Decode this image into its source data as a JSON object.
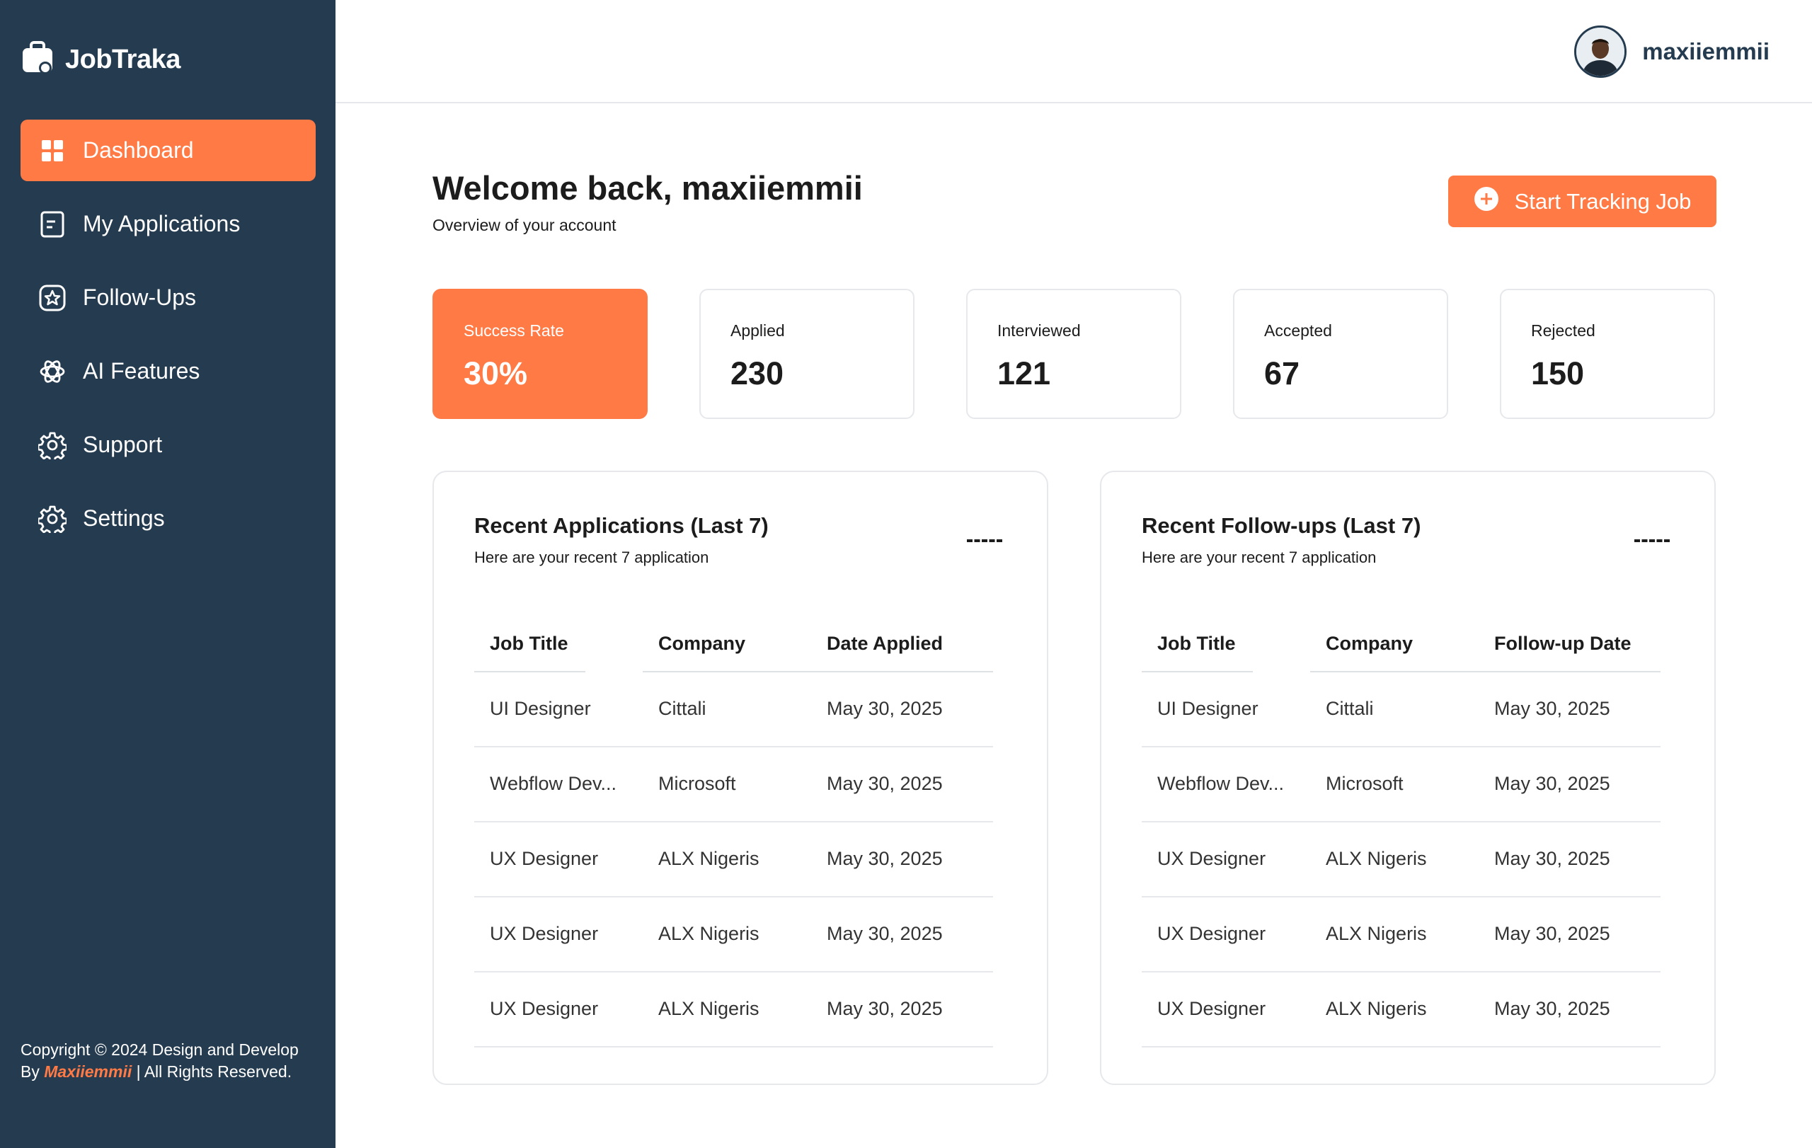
{
  "app": {
    "name": "JobTraka"
  },
  "sidebar": {
    "items": [
      {
        "label": "Dashboard",
        "icon": "dashboard-grid-icon",
        "active": true
      },
      {
        "label": "My Applications",
        "icon": "document-icon"
      },
      {
        "label": "Follow-Ups",
        "icon": "star-badge-icon"
      },
      {
        "label": "AI Features",
        "icon": "ai-knot-icon"
      },
      {
        "label": "Support",
        "icon": "gear-icon"
      },
      {
        "label": "Settings",
        "icon": "gear-icon"
      }
    ],
    "copyright_pre": "Copyright © 2024 Design and Develop By ",
    "copyright_brand": "Maxiiemmii",
    "copyright_post": " | All Rights Reserved."
  },
  "header": {
    "username": "maxiiemmii"
  },
  "main": {
    "welcome": "Welcome back, maxiiemmii",
    "subtitle": "Overview of your account",
    "start_button": "Start Tracking Job"
  },
  "stats": [
    {
      "label": "Success Rate",
      "value": "30%"
    },
    {
      "label": "Applied",
      "value": "230"
    },
    {
      "label": "Interviewed",
      "value": "121"
    },
    {
      "label": "Accepted",
      "value": "67"
    },
    {
      "label": "Rejected",
      "value": "150"
    }
  ],
  "recent_applications": {
    "title": "Recent Applications (Last 7)",
    "subtitle": "Here are your recent 7 application",
    "columns": [
      "Job Title",
      "Company",
      "Date Applied"
    ],
    "rows": [
      [
        "UI Designer",
        "Cittali",
        "May 30, 2025"
      ],
      [
        "Webflow Dev...",
        "Microsoft",
        "May 30, 2025"
      ],
      [
        "UX Designer",
        "ALX Nigeris",
        "May 30, 2025"
      ],
      [
        "UX Designer",
        "ALX Nigeris",
        "May 30, 2025"
      ],
      [
        "UX Designer",
        "ALX Nigeris",
        "May 30, 2025"
      ]
    ]
  },
  "recent_followups": {
    "title": "Recent Follow-ups (Last 7)",
    "subtitle": "Here are your recent 7 application",
    "columns": [
      "Job Title",
      "Company",
      "Follow-up Date"
    ],
    "rows": [
      [
        "UI Designer",
        "Cittali",
        "May 30, 2025"
      ],
      [
        "Webflow Dev...",
        "Microsoft",
        "May 30, 2025"
      ],
      [
        "UX Designer",
        "ALX Nigeris",
        "May 30, 2025"
      ],
      [
        "UX Designer",
        "ALX Nigeris",
        "May 30, 2025"
      ],
      [
        "UX Designer",
        "ALX Nigeris",
        "May 30, 2025"
      ]
    ]
  },
  "colors": {
    "sidebar": "#253b4f",
    "accent": "#ff7a45",
    "border": "#e6e8eb"
  }
}
